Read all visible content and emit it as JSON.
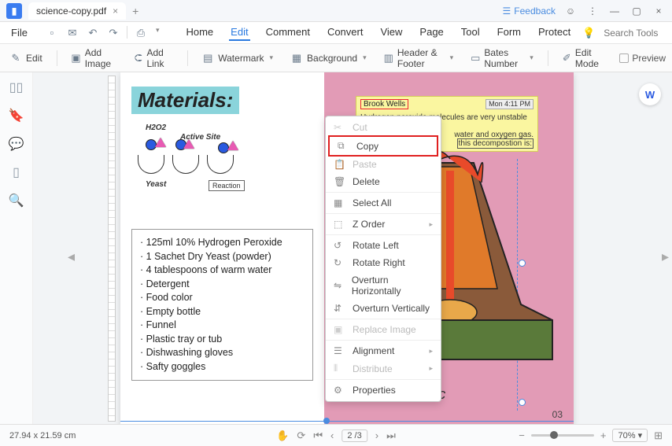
{
  "titlebar": {
    "filename": "science-copy.pdf",
    "feedback": "Feedback"
  },
  "menubar": {
    "file": "File",
    "tabs": [
      "Home",
      "Edit",
      "Comment",
      "Convert",
      "View",
      "Page",
      "Tool",
      "Form",
      "Protect"
    ],
    "active_tab": 1,
    "search_placeholder": "Search Tools"
  },
  "toolbar": {
    "edit_text": "Edit",
    "add_image": "Add Image",
    "add_link": "Add Link",
    "watermark": "Watermark",
    "background": "Background",
    "header_footer": "Header & Footer",
    "bates": "Bates Number",
    "edit_mode": "Edit Mode",
    "preview": "Preview"
  },
  "document": {
    "materials_heading": "Materials:",
    "diagram": {
      "h2o2": "H2O2",
      "active_site": "Active Site",
      "yeast": "Yeast",
      "reaction": "Reaction"
    },
    "materials_list": [
      "125ml 10% Hydrogen Peroxide",
      "1 Sachet Dry Yeast (powder)",
      "4 tablespoons of warm water",
      "Detergent",
      "Food color",
      "Empty bottle",
      "Funnel",
      "Plastic tray or tub",
      "Dishwashing gloves",
      "Safty goggles"
    ],
    "note": {
      "user": "Brook Wells",
      "time": "Mon 4:11 PM",
      "body1": "Hydrogen peroxide molecules are very unstable and",
      "body2_pre": "",
      "body2_mid": "water and oxygen gas.",
      "body3_pre": "",
      "body3_mid": "this decompostion is:"
    },
    "volcano_temp": "4400°c",
    "page_number": "03"
  },
  "context_menu": {
    "cut": "Cut",
    "copy": "Copy",
    "paste": "Paste",
    "delete": "Delete",
    "select_all": "Select All",
    "z_order": "Z Order",
    "rotate_left": "Rotate Left",
    "rotate_right": "Rotate Right",
    "overturn_h": "Overturn Horizontally",
    "overturn_v": "Overturn Vertically",
    "replace_image": "Replace Image",
    "alignment": "Alignment",
    "distribute": "Distribute",
    "properties": "Properties"
  },
  "statusbar": {
    "dims": "27.94 x 21.59 cm",
    "page": "2 /3",
    "zoom": "70%"
  },
  "colors": {
    "accent": "#2a7ae0",
    "highlight_red": "#e02020",
    "note_bg": "#faf6a0",
    "page_right_bg": "#e29bb6"
  }
}
